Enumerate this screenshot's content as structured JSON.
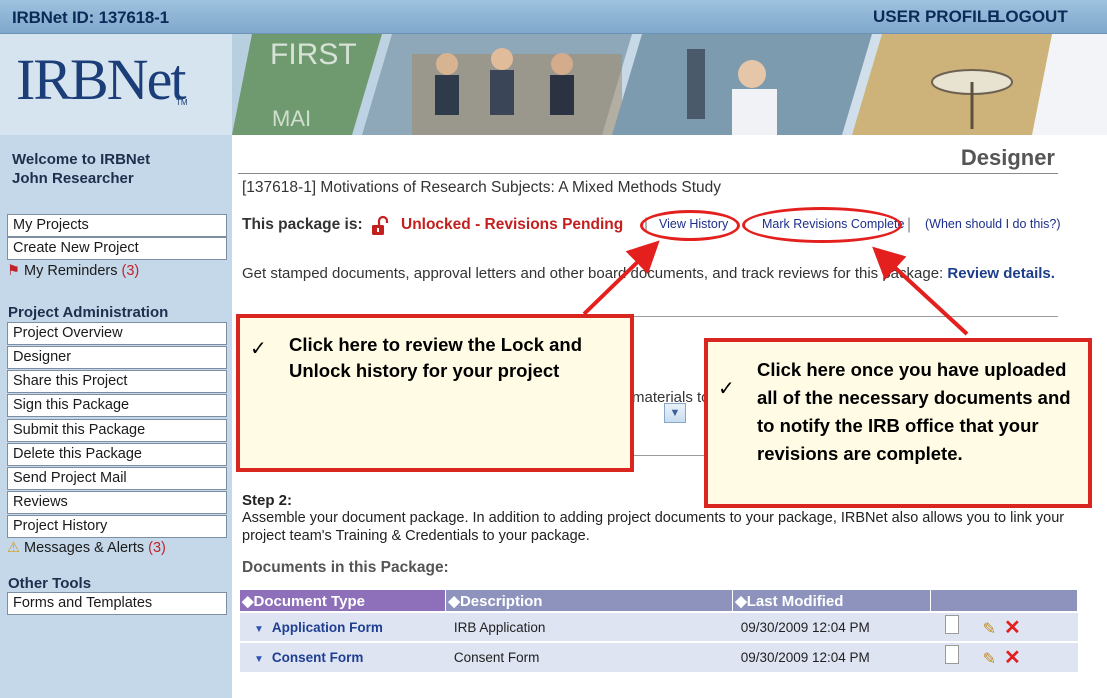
{
  "topbar": {
    "id_label": "IRBNet ID: 137618-1",
    "user_profile": "USER PROFILE",
    "logout": "LOGOUT"
  },
  "banner": {
    "logo": "IRBNet",
    "trademark": "TM"
  },
  "sidebar": {
    "welcome": "Welcome to IRBNet",
    "user_name": "John Researcher",
    "nav": [
      "My Projects",
      "Create New Project"
    ],
    "reminders": {
      "label": "My Reminders",
      "count": "(3)"
    },
    "project_admin_title": "Project Administration",
    "admin_items": [
      "Project Overview",
      "Designer",
      "Share this Project",
      "Sign this Package",
      "Submit this Package",
      "Delete this Package",
      "Send Project Mail",
      "Reviews",
      "Project History"
    ],
    "messages": {
      "label": "Messages & Alerts",
      "count": "(3)"
    },
    "other_tools_title": "Other Tools",
    "other_items": [
      "Forms and Templates"
    ]
  },
  "main": {
    "page_title": "Designer",
    "project_title": "[137618-1] Motivations of Research Subjects: A Mixed Methods Study",
    "package_label": "This package is:",
    "package_status": "Unlocked - Revisions Pending",
    "separator": "|",
    "view_history": "View History",
    "mark_complete": "Mark Revisions Complete",
    "when_link": "(When should I do this?)",
    "stamped_text": "Get stamped documents, approval letters and other board documents, and track reviews for this package:",
    "review_details": "Review details.",
    "materials_fragment": "materials to",
    "step2_label": "Step 2:",
    "step2_desc": "Assemble your document package. In addition to adding project documents to your package, IRBNet also allows you to link your project team's Training & Credentials to your package.",
    "docs_title": "Documents in this Package:",
    "table": {
      "headers": [
        "Document Type",
        "Description",
        "Last Modified"
      ],
      "rows": [
        {
          "type": "Application Form",
          "description": "IRB Application",
          "modified": "09/30/2009 12:04 PM"
        },
        {
          "type": "Consent Form",
          "description": "Consent Form",
          "modified": "09/30/2009 12:04 PM"
        }
      ]
    }
  },
  "callouts": {
    "history": {
      "check": "✓",
      "text": "Click here to review the Lock and Unlock history for your project"
    },
    "complete": {
      "check": "✓",
      "text": "Click here once you have uploaded all of the necessary documents and to notify the IRB office that your revisions are complete."
    }
  },
  "colors": {
    "accent_red": "#d9261e",
    "callout_bg": "#fffbe4",
    "sidebar_bg": "#c5d8e9",
    "link_blue": "#1c2f8a"
  }
}
